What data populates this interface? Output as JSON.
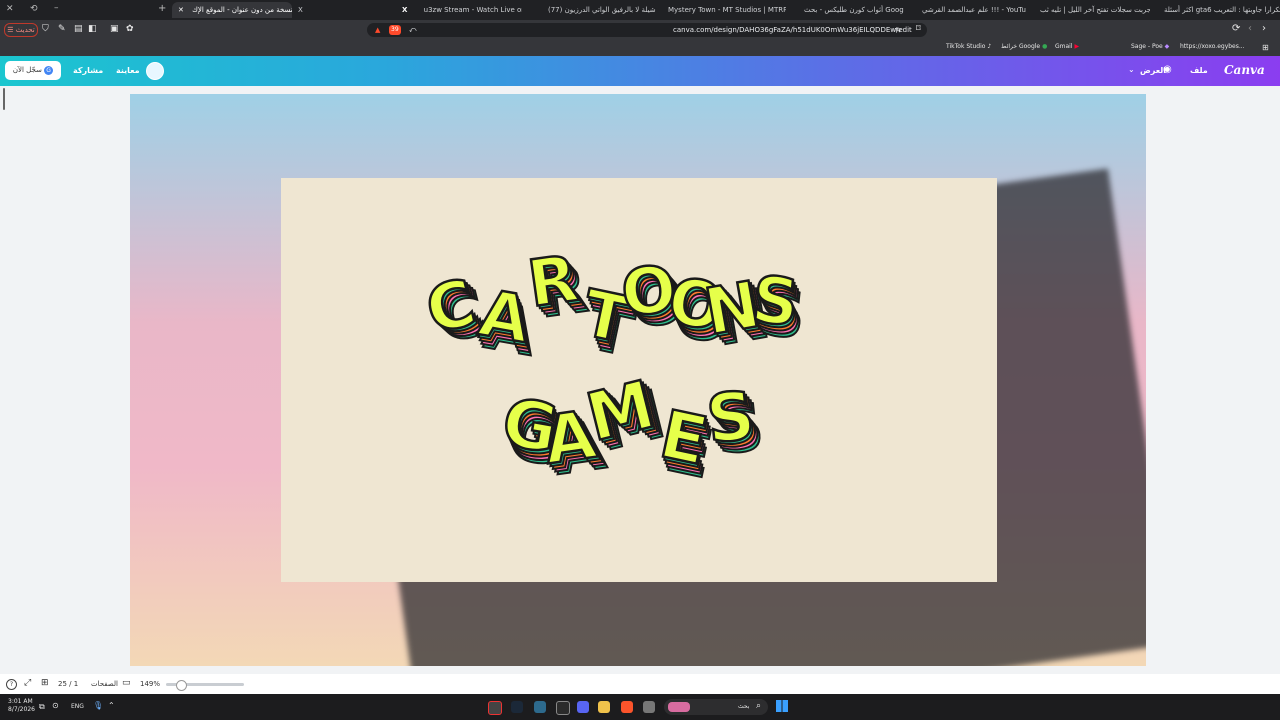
{
  "browser": {
    "tabs": [
      {
        "label": "اكثر أسئلة gta6 تكرارا جاوبتها : التعريب..."
      },
      {
        "label": "جربت سجلات تفتح آخر الليل | تليه ثب..."
      },
      {
        "label": "علم عبدالصمد القرشي !!! - YouTube"
      },
      {
        "label": "أثواب كورن طليكس - بحث Google"
      },
      {
        "label": "Mystery Town - MT Studios | MTRP"
      },
      {
        "label": "(77) شيلة لا بالرفيق الواتي الدرزيون ...."
      },
      {
        "label": "u3zw Stream - Watch Live on Kick"
      },
      {
        "label": "X"
      },
      {
        "label": "نسخة من دون عنوان - الموقع الإك..."
      }
    ],
    "refresh_label": "تحديث",
    "url": "canva.com/design/DAHO36gFaZA/h51dUK0OmWu36jEILQDDEw/edit",
    "bookmarks": [
      "https://xoxo.egybes...",
      "Sage - Poe",
      "Gmail",
      "YouTube",
      "خرائط Google",
      "TikTok Studio"
    ],
    "ext_badge": "39"
  },
  "canva": {
    "logo": "Canva",
    "file_label": "ملف",
    "show_label": "العرض",
    "signup_label": "سجّل الآن",
    "share_label": "مشاركة",
    "preview_label": "معاينة"
  },
  "slide_art": {
    "line1": "CARTOONS",
    "line2": "GAMES"
  },
  "footer": {
    "page_indicator": "25 / 1",
    "pages_label": "الصفحات",
    "zoom": "149%",
    "zoom_level": 0.18
  },
  "taskbar": {
    "time": "3:01 AM",
    "date": "8/7/2026",
    "lang": "ENG",
    "search_label": "بحث"
  },
  "colors": {
    "canva_gradient_start": "#1bc6cf",
    "canva_gradient_end": "#8b3df0",
    "letter_fill": "#e6ff4a",
    "letter_stripe1": "#2fbf8f",
    "letter_stripe2": "#ff6fb3",
    "letter_stripe3": "#ff7a2e",
    "slide_bg": "#efe6d2"
  }
}
